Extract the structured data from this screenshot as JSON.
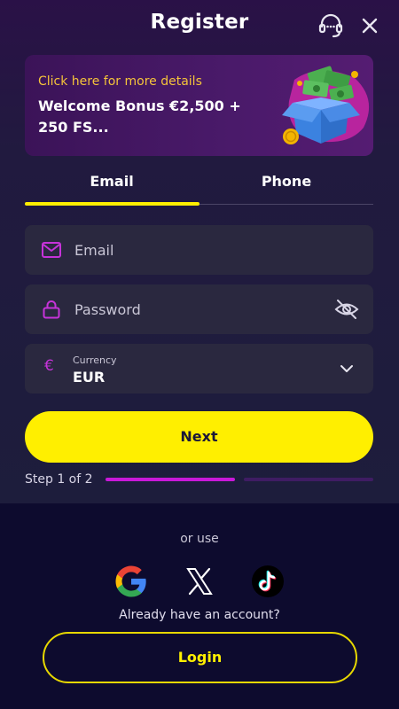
{
  "header": {
    "title": "Register",
    "support_icon": "headset-icon",
    "close_icon": "close-icon"
  },
  "banner": {
    "link_text": "Click here for more details",
    "bonus_text": "Welcome Bonus €2,500 + 250 FS...",
    "art": "gift-box-money-icon"
  },
  "tabs": [
    {
      "label": "Email",
      "active": true
    },
    {
      "label": "Phone",
      "active": false
    }
  ],
  "form": {
    "email": {
      "placeholder": "Email",
      "value": "",
      "icon": "envelope-icon"
    },
    "password": {
      "placeholder": "Password",
      "value": "",
      "icon": "lock-icon",
      "toggle_icon": "eye-off-icon"
    },
    "currency": {
      "label": "Currency",
      "value": "EUR",
      "symbol": "€"
    },
    "next_label": "Next"
  },
  "progress": {
    "text": "Step 1 of 2",
    "current": 1,
    "total": 2
  },
  "social": {
    "or_use": "or use",
    "providers": [
      "google-icon",
      "x-icon",
      "tiktok-icon"
    ],
    "already_text": "Already have an account?",
    "login_label": "Login"
  },
  "colors": {
    "accent": "#ffef00",
    "magenta": "#c918d9",
    "link": "#f5c43a",
    "background": "#0c0b2c",
    "field": "#2a283f"
  }
}
